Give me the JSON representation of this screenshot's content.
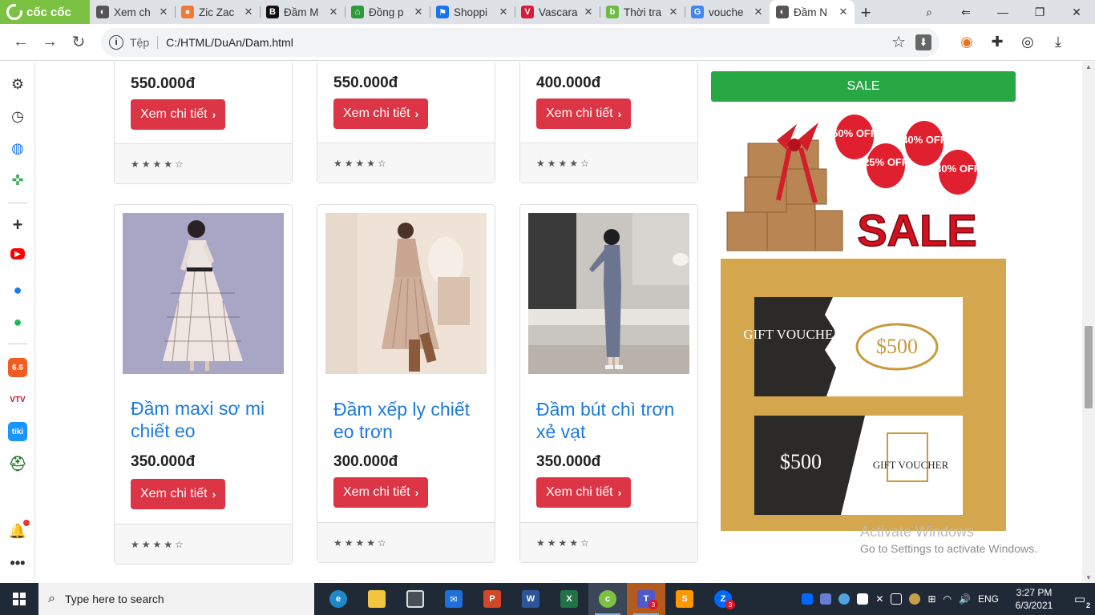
{
  "browser": {
    "brand": "cốc cốc",
    "tabs": [
      {
        "title": "Xem ch",
        "color": "#555555",
        "glyph": "◐"
      },
      {
        "title": "Zic Zac",
        "color": "#f07a3c",
        "glyph": "●"
      },
      {
        "title": "Đầm M",
        "color": "#111111",
        "glyph": "B"
      },
      {
        "title": "Đồng p",
        "color": "#2e9a3d",
        "glyph": "⌂"
      },
      {
        "title": "Shoppi",
        "color": "#1a73e8",
        "glyph": "⚑"
      },
      {
        "title": "Vascara",
        "color": "#d81b3c",
        "glyph": "V"
      },
      {
        "title": "Thời tra",
        "color": "#6cbd45",
        "glyph": "b"
      },
      {
        "title": "vouche",
        "color": "#4285f4",
        "glyph": "G"
      },
      {
        "title": "Đầm N",
        "color": "#555555",
        "glyph": "◐",
        "active": true
      }
    ],
    "address": {
      "scheme": "Tệp",
      "url": "C:/HTML/DuAn/Dam.html"
    }
  },
  "products_top": [
    {
      "price": "550.000đ",
      "button": "Xem chi tiết",
      "rating": "★★★★☆"
    },
    {
      "price": "550.000đ",
      "button": "Xem chi tiết",
      "rating": "★★★★☆"
    },
    {
      "price": "400.000đ",
      "button": "Xem chi tiết",
      "rating": "★★★★☆"
    }
  ],
  "products": [
    {
      "name": "Đầm maxi sơ mi chiết eo",
      "price": "350.000đ",
      "button": "Xem chi tiết",
      "rating": "★★★★☆"
    },
    {
      "name": "Đầm xếp ly chiết eo trơn",
      "price": "300.000đ",
      "button": "Xem chi tiết",
      "rating": "★★★★☆"
    },
    {
      "name": "Đầm bút chì trơn xẻ vạt",
      "price": "350.000đ",
      "button": "Xem chi tiết",
      "rating": "★★★★☆"
    }
  ],
  "sale": {
    "button": "SALE",
    "balloons": [
      "50% OFF",
      "40% OFF",
      "25% OFF",
      "30% OFF"
    ],
    "banner_text": "SALE",
    "voucher1": {
      "left": "GIFT VOUCHER",
      "amount": "$500"
    },
    "voucher2": {
      "amount": "$500",
      "right": "GIFT VOUCHER"
    }
  },
  "watermark": {
    "line1": "Activate Windows",
    "line2": "Go to Settings to activate Windows."
  },
  "taskbar": {
    "search_placeholder": "Type here to search",
    "time": "3:27 PM",
    "date": "6/3/2021",
    "language": "ENG",
    "teams_badge": "3",
    "zalo_badge": "3",
    "notify_badge": "2"
  },
  "colors": {
    "accent_red": "#dc3545",
    "link_blue": "#1d7ae0",
    "sale_green": "#28a745",
    "voucher_gold": "#d4a74e"
  }
}
